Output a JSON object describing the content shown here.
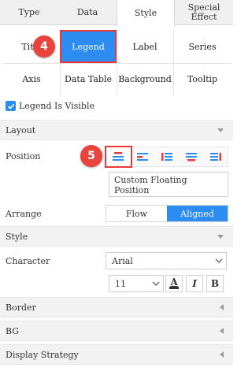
{
  "top_tabs": [
    "Type",
    "Data",
    "Style",
    "Special Effect"
  ],
  "sub_tabs": {
    "row1": [
      "Title",
      "Legend",
      "Label",
      "Series"
    ],
    "row2": [
      "Axis",
      "Data Table",
      "Background",
      "Tooltip"
    ]
  },
  "markers": {
    "first": "4",
    "second": "5"
  },
  "legend_visible_label": "Legend Is Visible",
  "sections": {
    "layout": "Layout",
    "style": "Style",
    "border": "Border",
    "bg": "BG",
    "display_strategy": "Display Strategy"
  },
  "position": {
    "label": "Position",
    "custom_floating": "Custom Floating Position"
  },
  "arrange": {
    "label": "Arrange",
    "options": [
      "Flow",
      "Aligned"
    ],
    "selected": "Aligned"
  },
  "character": {
    "label": "Character",
    "font": "Arial",
    "size": "11",
    "bold_label": "B",
    "italic_label": "I",
    "color_label": "A"
  },
  "colors": {
    "accent": "#2d8cf0",
    "highlight": "#e83a3a"
  }
}
